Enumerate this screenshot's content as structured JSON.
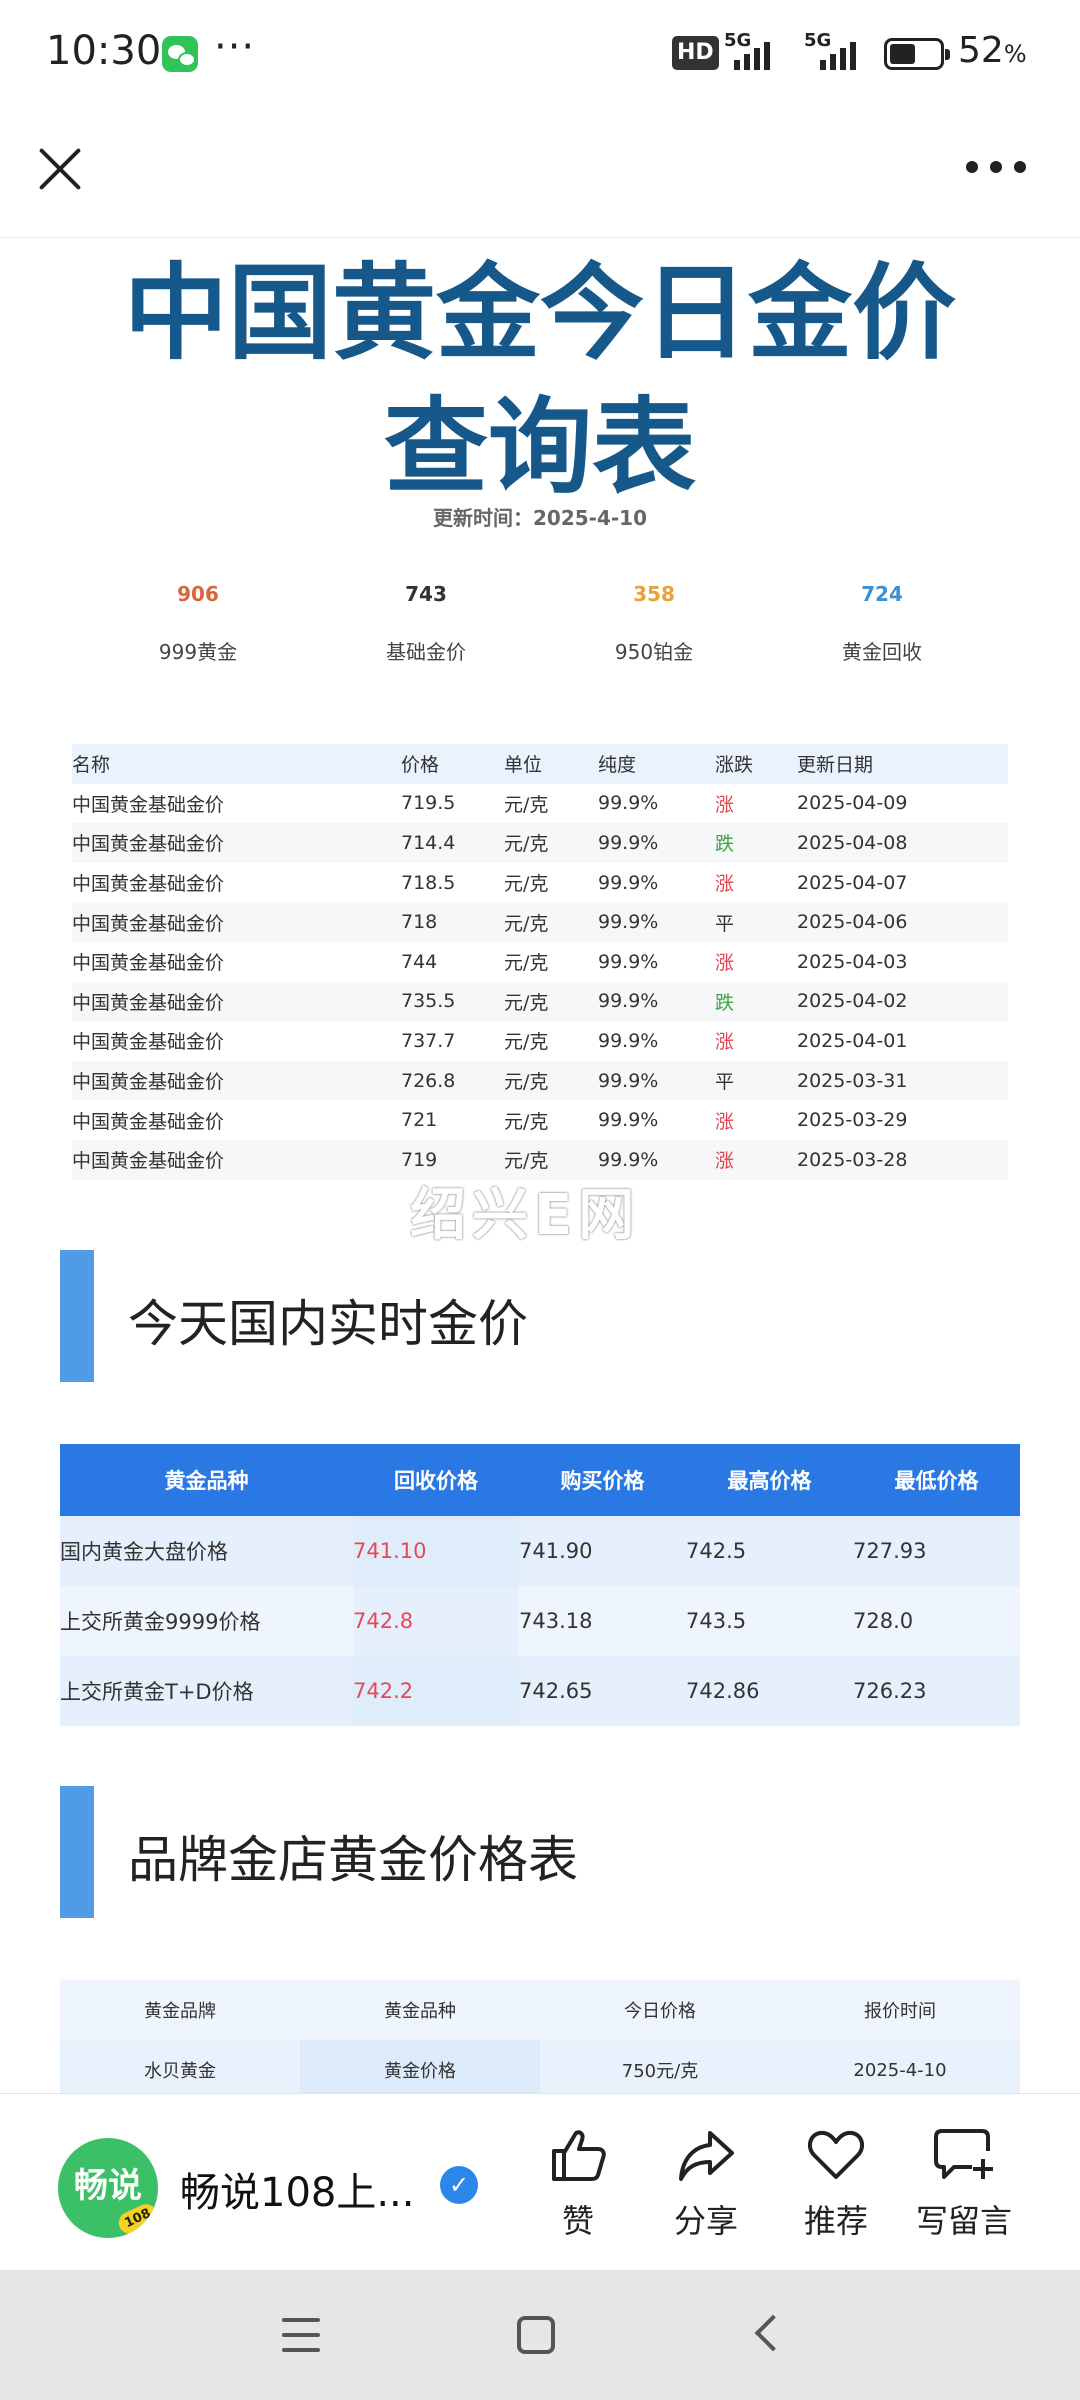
{
  "status_bar": {
    "time": "10:30",
    "dots": "···",
    "hd_label": "HD",
    "net1": "5G",
    "net2": "5G",
    "battery_pct": "52",
    "battery_unit": "%",
    "battery_level": 0.52
  },
  "toolbar": {
    "close_icon": "close-icon",
    "more_icon": "more-icon"
  },
  "article": {
    "title_line1": "中国黄金今日金价",
    "title_line2": "查询表",
    "update_time": "更新时间：2025-4-10",
    "stats": [
      {
        "value": "906",
        "label": "999黄金",
        "color": "#d9653a"
      },
      {
        "value": "743",
        "label": "基础金价",
        "color": "#333333"
      },
      {
        "value": "358",
        "label": "950铂金",
        "color": "#e9a23b"
      },
      {
        "value": "724",
        "label": "黄金回收",
        "color": "#3c8fd1"
      }
    ],
    "price_table": {
      "headers": [
        "名称",
        "价格",
        "单位",
        "纯度",
        "涨跌",
        "更新日期"
      ],
      "rows": [
        [
          "中国黄金基础金价",
          "719.5",
          "元/克",
          "99.9%",
          "涨",
          "2025-04-09"
        ],
        [
          "中国黄金基础金价",
          "714.4",
          "元/克",
          "99.9%",
          "跌",
          "2025-04-08"
        ],
        [
          "中国黄金基础金价",
          "718.5",
          "元/克",
          "99.9%",
          "涨",
          "2025-04-07"
        ],
        [
          "中国黄金基础金价",
          "718",
          "元/克",
          "99.9%",
          "平",
          "2025-04-06"
        ],
        [
          "中国黄金基础金价",
          "744",
          "元/克",
          "99.9%",
          "涨",
          "2025-04-03"
        ],
        [
          "中国黄金基础金价",
          "735.5",
          "元/克",
          "99.9%",
          "跌",
          "2025-04-02"
        ],
        [
          "中国黄金基础金价",
          "737.7",
          "元/克",
          "99.9%",
          "涨",
          "2025-04-01"
        ],
        [
          "中国黄金基础金价",
          "726.8",
          "元/克",
          "99.9%",
          "平",
          "2025-03-31"
        ],
        [
          "中国黄金基础金价",
          "721",
          "元/克",
          "99.9%",
          "涨",
          "2025-03-29"
        ],
        [
          "中国黄金基础金价",
          "719",
          "元/克",
          "99.9%",
          "涨",
          "2025-03-28"
        ]
      ]
    },
    "watermark": "绍兴E网",
    "section1_title": "今天国内实时金价",
    "realtime_table": {
      "headers": [
        "黄金品种",
        "回收价格",
        "购买价格",
        "最高价格",
        "最低价格"
      ],
      "rows": [
        [
          "国内黄金大盘价格",
          "741.10",
          "741.90",
          "742.5",
          "727.93"
        ],
        [
          "上交所黄金9999价格",
          "742.8",
          "743.18",
          "743.5",
          "728.0"
        ],
        [
          "上交所黄金T+D价格",
          "742.2",
          "742.65",
          "742.86",
          "726.23"
        ]
      ]
    },
    "section2_title": "品牌金店黄金价格表",
    "brand_table": {
      "headers": [
        "黄金品牌",
        "黄金品种",
        "今日价格",
        "报价时间"
      ],
      "rows": [
        [
          "水贝黄金",
          "黄金价格",
          "750元/克",
          "2025-4-10"
        ]
      ]
    }
  },
  "action_bar": {
    "avatar_text": "畅说",
    "avatar_tag": "108",
    "author": "畅说108上...",
    "actions": [
      {
        "label": "赞",
        "icon": "thumbs-up-icon"
      },
      {
        "label": "分享",
        "icon": "share-icon"
      },
      {
        "label": "推荐",
        "icon": "heart-icon"
      },
      {
        "label": "写留言",
        "icon": "comment-icon"
      }
    ]
  }
}
